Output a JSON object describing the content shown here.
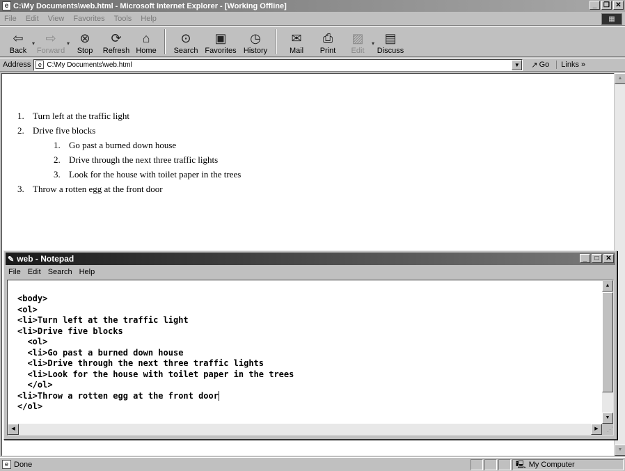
{
  "ie": {
    "title": "C:\\My Documents\\web.html - Microsoft Internet Explorer - [Working Offline]",
    "menu": [
      "File",
      "Edit",
      "View",
      "Favorites",
      "Tools",
      "Help"
    ],
    "toolbar": {
      "back": "Back",
      "forward": "Forward",
      "stop": "Stop",
      "refresh": "Refresh",
      "home": "Home",
      "search": "Search",
      "favorites": "Favorites",
      "history": "History",
      "mail": "Mail",
      "print": "Print",
      "edit": "Edit",
      "discuss": "Discuss"
    },
    "address": {
      "label": "Address",
      "value": "C:\\My Documents\\web.html",
      "go": "Go",
      "links": "Links"
    },
    "status": {
      "text": "Done",
      "zone": "My Computer"
    }
  },
  "page": {
    "list": [
      {
        "num": "1.",
        "text": "Turn left at the traffic light"
      },
      {
        "num": "2.",
        "text": "Drive five blocks"
      },
      {
        "num": "3.",
        "text": "Throw a rotten egg at the front door"
      }
    ],
    "sublist": [
      {
        "num": "1.",
        "text": "Go past a burned down house"
      },
      {
        "num": "2.",
        "text": "Drive through the next three traffic lights"
      },
      {
        "num": "3.",
        "text": "Look for the house with toilet paper in the trees"
      }
    ]
  },
  "notepad": {
    "title": "web - Notepad",
    "menu": [
      "File",
      "Edit",
      "Search",
      "Help"
    ],
    "lines": [
      "<body>",
      "<ol>",
      "<li>Turn left at the traffic light",
      "<li>Drive five blocks",
      "  <ol>",
      "  <li>Go past a burned down house",
      "  <li>Drive through the next three traffic lights",
      "  <li>Look for the house with toilet paper in the trees",
      "  </ol>",
      "<li>Throw a rotten egg at the front door",
      "</ol>"
    ]
  },
  "icons": {
    "back": "back-arrow-icon",
    "forward": "forward-arrow-icon",
    "stop": "stop-icon",
    "refresh": "refresh-icon",
    "home": "home-icon",
    "search": "search-icon",
    "favorites": "favorites-icon",
    "history": "history-icon",
    "mail": "mail-icon",
    "print": "print-icon",
    "edit": "edit-icon",
    "discuss": "discuss-icon"
  }
}
